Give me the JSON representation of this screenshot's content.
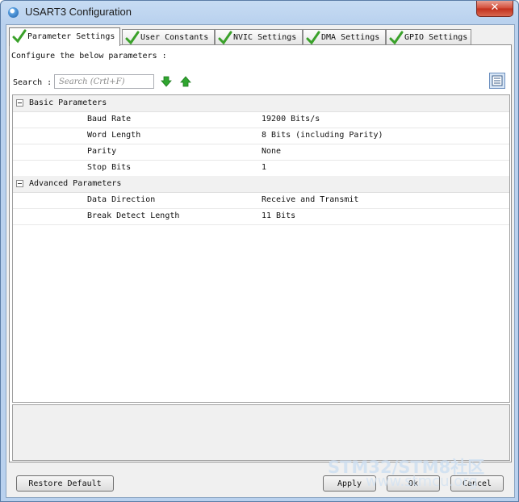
{
  "window": {
    "title": "USART3 Configuration",
    "close_label": "✕"
  },
  "tabs": [
    {
      "label": "Parameter Settings",
      "active": true
    },
    {
      "label": "User Constants",
      "active": false
    },
    {
      "label": "NVIC Settings",
      "active": false
    },
    {
      "label": "DMA Settings",
      "active": false
    },
    {
      "label": "GPIO Settings",
      "active": false
    }
  ],
  "intro_text": "Configure the below parameters :",
  "search": {
    "label": "Search :",
    "placeholder": "Search (Crtl+F)"
  },
  "groups": [
    {
      "label": "Basic Parameters",
      "params": [
        {
          "name": "Baud Rate",
          "value": "19200 Bits/s"
        },
        {
          "name": "Word Length",
          "value": "8 Bits (including Parity)"
        },
        {
          "name": "Parity",
          "value": "None"
        },
        {
          "name": "Stop Bits",
          "value": "1"
        }
      ]
    },
    {
      "label": "Advanced Parameters",
      "params": [
        {
          "name": "Data Direction",
          "value": "Receive and Transmit"
        },
        {
          "name": "Break Detect Length",
          "value": "11 Bits"
        }
      ]
    }
  ],
  "buttons": {
    "restore": "Restore Default",
    "apply": "Apply",
    "ok": "Ok",
    "cancel": "Cancel"
  },
  "watermark": {
    "line1": "STM32/STM8社区",
    "line2": "www.stmcu.org"
  },
  "colors": {
    "check_green": "#3aa12a",
    "arrow_green": "#2fa52f",
    "title_bar": "#b9d1ee"
  }
}
